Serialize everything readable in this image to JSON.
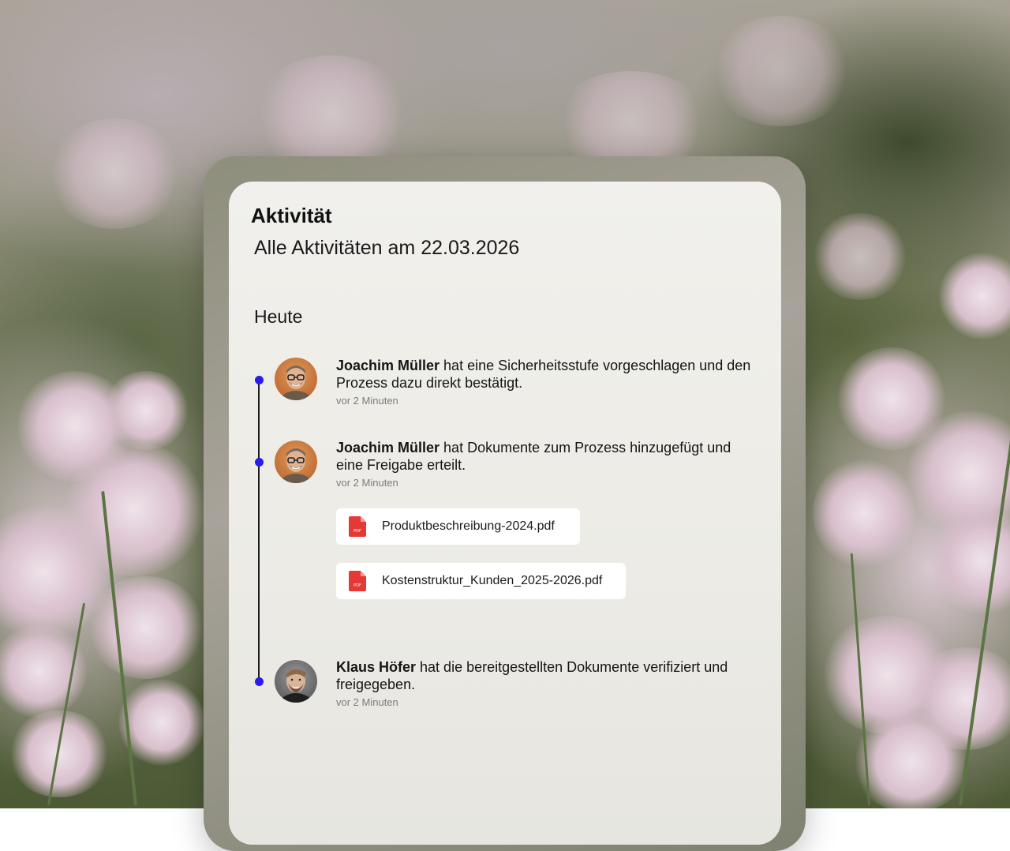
{
  "card": {
    "title": "Aktivität",
    "subtitle": "Alle Aktivitäten am 22.03.2026",
    "section_label": "Heute"
  },
  "accent_color": "#2a1bf0",
  "pdf_icon_color": "#e53935",
  "activities": [
    {
      "user": "Joachim Müller",
      "text": " hat eine Sicherheitsstufe vorgeschlagen und den Prozess  dazu direkt bestätigt.",
      "time": "vor 2 Minuten",
      "avatar": "avatar-joachim-mueller"
    },
    {
      "user": "Joachim Müller",
      "text": " hat Dokumente zum Prozess hinzugefügt und eine  Freigabe erteilt.",
      "time": "vor 2 Minuten",
      "avatar": "avatar-joachim-mueller",
      "files": [
        {
          "name": "Produktbeschreibung-2024.pdf",
          "icon": "pdf-file-icon",
          "icon_label": "PDF"
        },
        {
          "name": "Kostenstruktur_Kunden_2025-2026.pdf",
          "icon": "pdf-file-icon",
          "icon_label": "PDF"
        }
      ]
    },
    {
      "user": "Klaus Höfer",
      "text": " hat die bereitgestellten Dokumente verifiziert und freigegeben.",
      "time": "vor 2 Minuten",
      "avatar": "avatar-klaus-hoefer"
    }
  ]
}
